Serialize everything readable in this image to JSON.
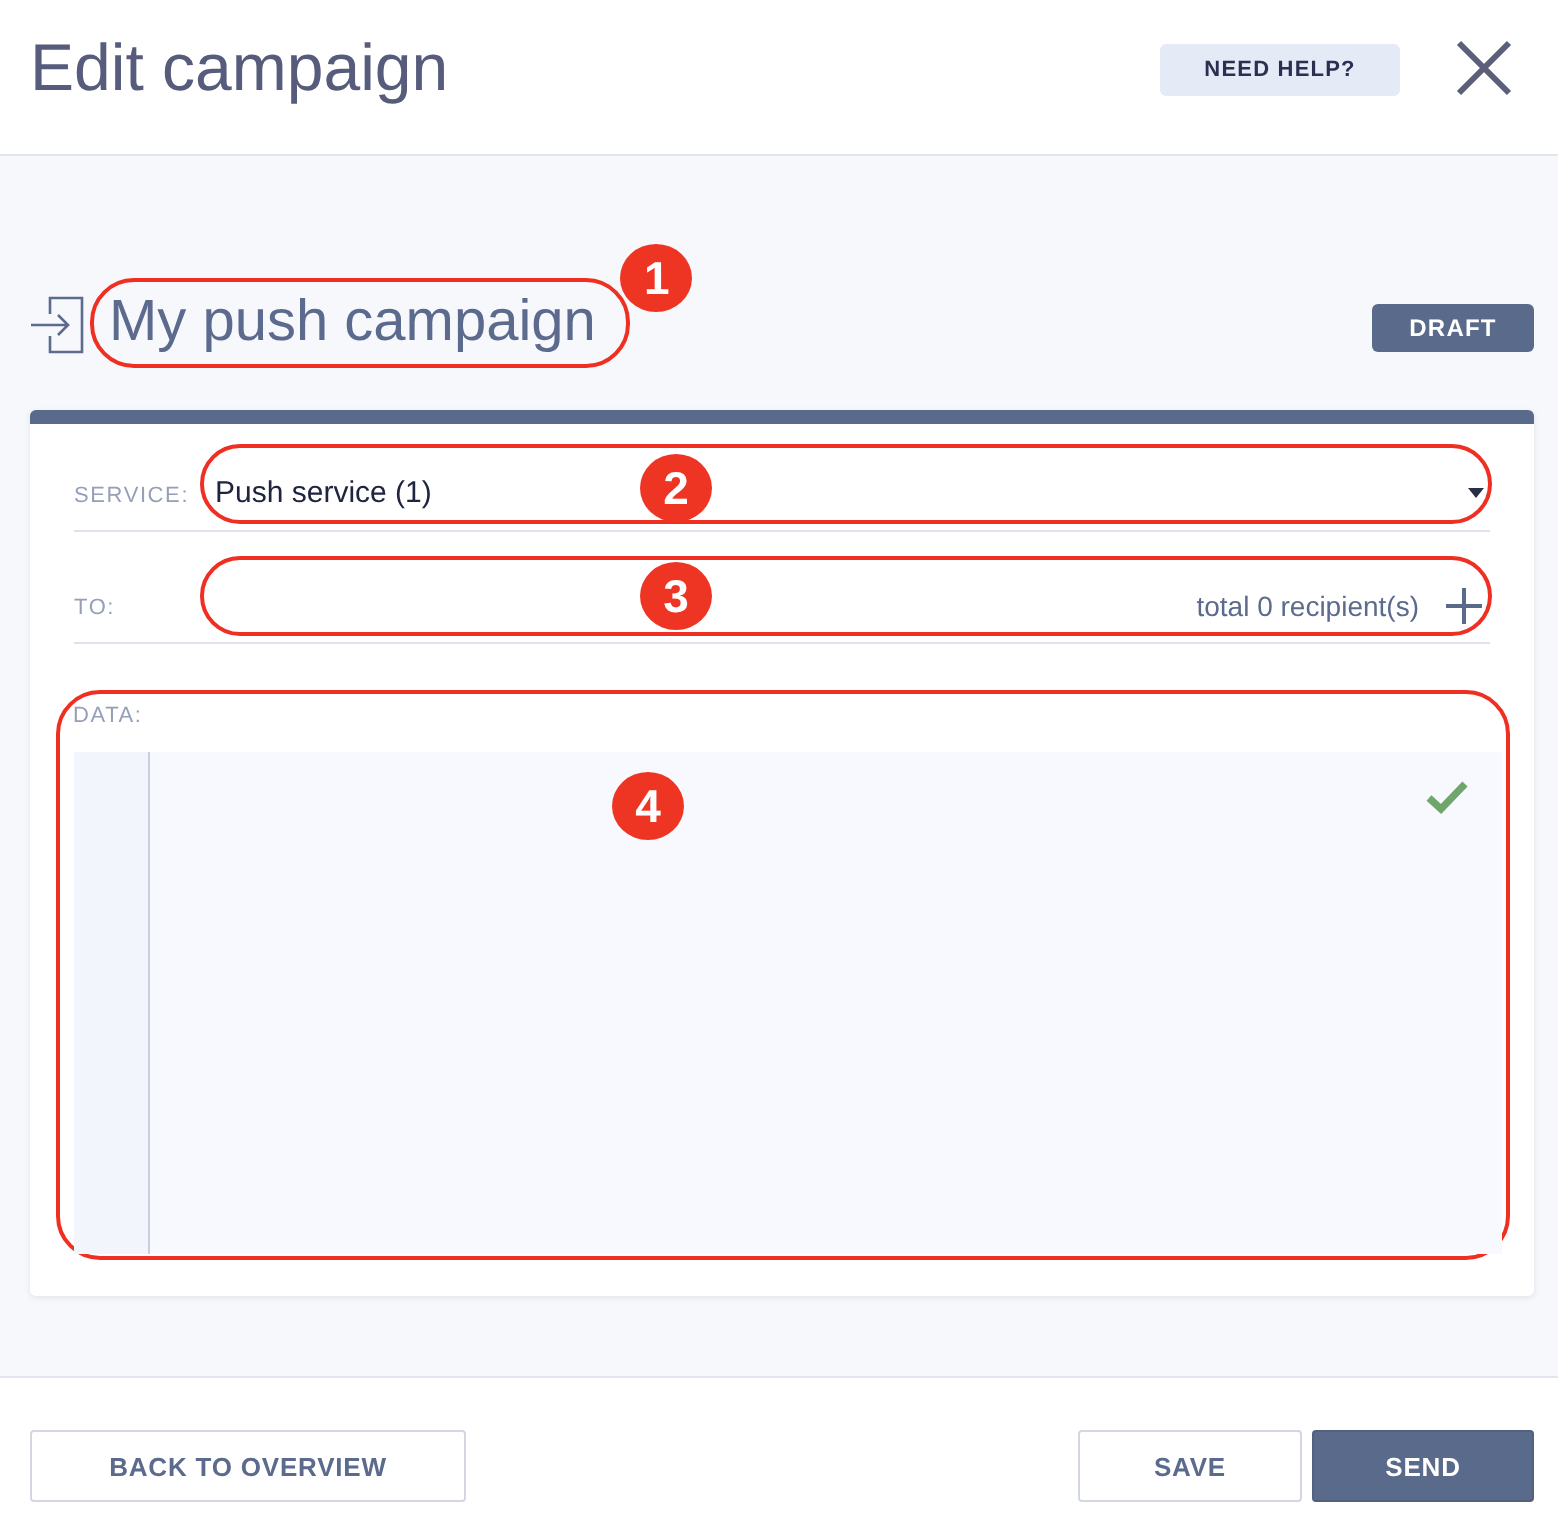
{
  "header": {
    "title": "Edit campaign",
    "help_button": "NEED HELP?"
  },
  "campaign": {
    "name": "My push campaign",
    "status": "DRAFT",
    "callout": "1"
  },
  "form": {
    "fields": [
      {
        "kind": "select",
        "label": "SERVICE:",
        "value": "Push service (1)",
        "callout": "2"
      },
      {
        "kind": "recipients",
        "label": "TO:",
        "summary": "total 0 recipient(s)",
        "callout": "3"
      },
      {
        "kind": "editor",
        "label": "DATA:",
        "valid": true,
        "callout": "4"
      }
    ]
  },
  "footer": {
    "buttons": [
      {
        "label": "BACK TO OVERVIEW",
        "kind": "secondary"
      },
      {
        "label": "SAVE",
        "kind": "secondary"
      },
      {
        "label": "SEND",
        "kind": "primary"
      }
    ]
  }
}
